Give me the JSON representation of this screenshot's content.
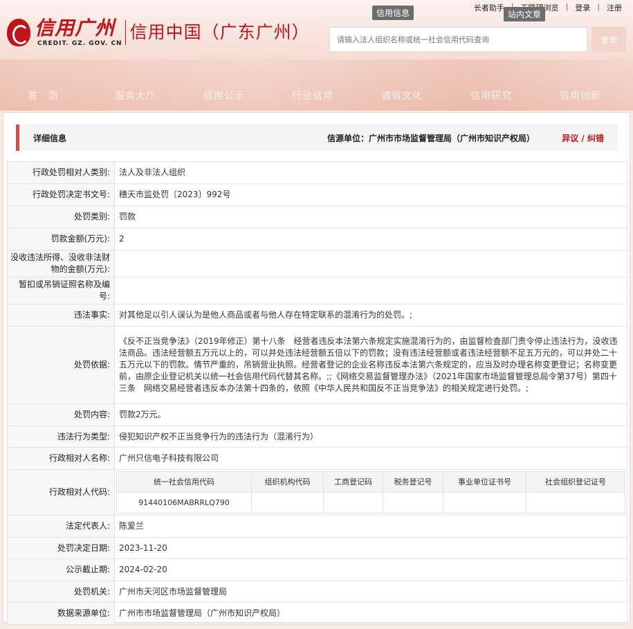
{
  "site": {
    "logo_text": "信用广州",
    "logo_sub": "CREDIT. GZ. GOV. CN",
    "slogan": "信用中国（广东广州）",
    "toplinks": [
      "长者助手",
      "无障碍浏览",
      "登录",
      "注册"
    ],
    "tag_info": "信用信息",
    "tag_site": "站内文章",
    "search_placeholder": "请输入法人组织名称或统一社会信用代码查询",
    "search_button": "查询",
    "nav": [
      "首　页",
      "服务大厅",
      "信用公示",
      "行业信用",
      "诚信文化",
      "信用研究",
      "信用创新"
    ]
  },
  "detail": {
    "title": "详细信息",
    "source": "信源单位：广州市市场监督管理局（广州市知识产权局）",
    "objection": "异议 / 纠错",
    "rows": [
      {
        "label": "行政处罚相对人类别:",
        "value": "法人及非法人组织"
      },
      {
        "label": "行政处罚决定书文号:",
        "value": "穗天市监处罚〔2023〕992号"
      },
      {
        "label": "处罚类别:",
        "value": "罚款"
      },
      {
        "label": "罚款金额(万元):",
        "value": "2"
      },
      {
        "label": "没收违法所得、没收非法财物的金额(万元):",
        "value": ""
      },
      {
        "label": "暂扣或吊销证照名称及编号:",
        "value": ""
      },
      {
        "label": "违法事实:",
        "value": "对其他足以引人误认为是他人商品或者与他人存在特定联系的混淆行为的处罚。;"
      },
      {
        "label": "处罚依据:",
        "value": "《反不正当竞争法》（2019年修正）第十八条　经营者违反本法第六条规定实施混淆行为的，由监督检查部门责令停止违法行为，没收违法商品。违法经营额五万元以上的，可以并处违法经营额五倍以下的罚款；没有违法经营额或者违法经营额不足五万元的，可以并处二十五万元以下的罚款。情节严重的，吊销营业执照。经营者登记的企业名称违反本法第六条规定的，应当及时办理名称变更登记；名称变更前，由原企业登记机关以统一社会信用代码代替其名称。;;《网络交易监督管理办法》（2021年国家市场监督管理总局令第37号）第四十三条　网络交易经营者违反本办法第十四条的，依照《中华人民共和国反不正当竞争法》的相关规定进行处罚。;"
      },
      {
        "label": "处罚内容:",
        "value": "罚款2万元。"
      },
      {
        "label": "违法行为类型:",
        "value": "侵犯知识产权不正当竞争行为的违法行为（混淆行为）"
      },
      {
        "label": "行政相对人名称:",
        "value": "广州只信电子科技有限公司"
      }
    ],
    "code_row": {
      "label": "行政相对人代码:",
      "headers": [
        "统一社会信用代码",
        "组织机构代码",
        "工商登记码",
        "税务登记号",
        "事业单位证书号",
        "社会组织登记证号"
      ],
      "values": [
        "91440106MABRRLQ790",
        "",
        "",
        "",
        "",
        ""
      ]
    },
    "tail_rows": [
      {
        "label": "法定代表人:",
        "value": "陈爱兰"
      },
      {
        "label": "处罚决定日期:",
        "value": "2023-11-20"
      },
      {
        "label": "公示截止期:",
        "value": "2024-02-20"
      },
      {
        "label": "处罚机关:",
        "value": "广州市天河区市场监督管理局"
      },
      {
        "label": "数据来源单位:",
        "value": "广州市市场监督管理局（广州市知识产权局）"
      }
    ]
  },
  "colors": {
    "brand": "#c0141b",
    "accent_bar": "#d94a4a"
  }
}
